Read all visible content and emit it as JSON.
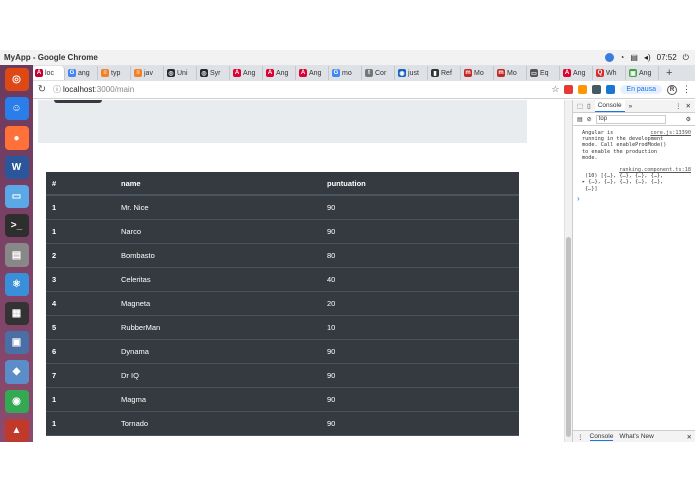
{
  "window": {
    "title": "MyApp - Google Chrome"
  },
  "system_tray": {
    "time": "07:52"
  },
  "tabs": [
    {
      "label": "loc",
      "color": "#c3002f",
      "glyph": "A"
    },
    {
      "label": "ang",
      "color": "#4285f4",
      "glyph": "G"
    },
    {
      "label": "typ",
      "color": "#f48024",
      "glyph": "≡"
    },
    {
      "label": "jav",
      "color": "#f48024",
      "glyph": "≡"
    },
    {
      "label": "Uni",
      "color": "#24292e",
      "glyph": "◎"
    },
    {
      "label": "Syr",
      "color": "#24292e",
      "glyph": "◎"
    },
    {
      "label": "Ang",
      "color": "#dd0031",
      "glyph": "A"
    },
    {
      "label": "Ang",
      "color": "#dd0031",
      "glyph": "A"
    },
    {
      "label": "Ang",
      "color": "#dd0031",
      "glyph": "A"
    },
    {
      "label": "mo",
      "color": "#4285f4",
      "glyph": "G"
    },
    {
      "label": "Cor",
      "color": "#777777",
      "glyph": "t"
    },
    {
      "label": "just",
      "color": "#1565c0",
      "glyph": "◉"
    },
    {
      "label": "Ref",
      "color": "#333333",
      "glyph": "▮"
    },
    {
      "label": "Mo",
      "color": "#c62828",
      "glyph": "m"
    },
    {
      "label": "Mo",
      "color": "#c62828",
      "glyph": "m"
    },
    {
      "label": "Eq",
      "color": "#555555",
      "glyph": "▭"
    },
    {
      "label": "Ang",
      "color": "#dd0031",
      "glyph": "A"
    },
    {
      "label": "Wh",
      "color": "#d32f2f",
      "glyph": "Q"
    },
    {
      "label": "Ang",
      "color": "#43a047",
      "glyph": "▣"
    }
  ],
  "address": {
    "host": "localhost",
    "path": ":3000/main",
    "pause_label": "En pausa",
    "avatar_letter": "R"
  },
  "table": {
    "headers": [
      "#",
      "name",
      "puntuation"
    ],
    "rows": [
      [
        "1",
        "Mr. Nice",
        "90"
      ],
      [
        "1",
        "Narco",
        "90"
      ],
      [
        "2",
        "Bombasto",
        "80"
      ],
      [
        "3",
        "Celeritas",
        "40"
      ],
      [
        "4",
        "Magneta",
        "20"
      ],
      [
        "5",
        "RubberMan",
        "10"
      ],
      [
        "6",
        "Dynama",
        "90"
      ],
      [
        "7",
        "Dr IQ",
        "90"
      ],
      [
        "1",
        "Magma",
        "90"
      ],
      [
        "1",
        "Tornado",
        "90"
      ]
    ]
  },
  "devtools": {
    "tab_console": "Console",
    "filter_value": "top",
    "msg1_lines": [
      "Angular is",
      "running in the development",
      "mode. Call enableProdMode()",
      "to enable the production",
      "mode."
    ],
    "msg1_source": "core.js:13390",
    "msg2_source": "ranking.component.ts:18",
    "msg2_lines": [
      "(10) [{…}, {…}, {…}, {…},",
      "{…}, {…}, {…}, {…}, {…},",
      "{…}]"
    ],
    "bottom_console": "Console",
    "bottom_whatsnew": "What's New"
  },
  "dock": [
    {
      "name": "ubuntu-logo-icon",
      "color": "#dd4814",
      "glyph": "◎"
    },
    {
      "name": "finder-icon",
      "color": "#2b7de9",
      "glyph": "☺"
    },
    {
      "name": "firefox-icon",
      "color": "#ff7139",
      "glyph": "●"
    },
    {
      "name": "word-icon",
      "color": "#2b579a",
      "glyph": "W"
    },
    {
      "name": "folder-icon",
      "color": "#5aa9e6",
      "glyph": "▭"
    },
    {
      "name": "terminal-icon",
      "color": "#2e2e2e",
      "glyph": ">_"
    },
    {
      "name": "drive-icon",
      "color": "#888888",
      "glyph": "▤"
    },
    {
      "name": "atom-icon",
      "color": "#3a8fd9",
      "glyph": "⚛"
    },
    {
      "name": "monitor-icon",
      "color": "#333333",
      "glyph": "▦"
    },
    {
      "name": "screenshot-icon",
      "color": "#4a6fa5",
      "glyph": "▣"
    },
    {
      "name": "app-icon",
      "color": "#5b8ec9",
      "glyph": "◆"
    },
    {
      "name": "chrome-icon",
      "color": "#34a853",
      "glyph": "◉"
    },
    {
      "name": "gift-icon",
      "color": "#c0392b",
      "glyph": "▲"
    }
  ]
}
